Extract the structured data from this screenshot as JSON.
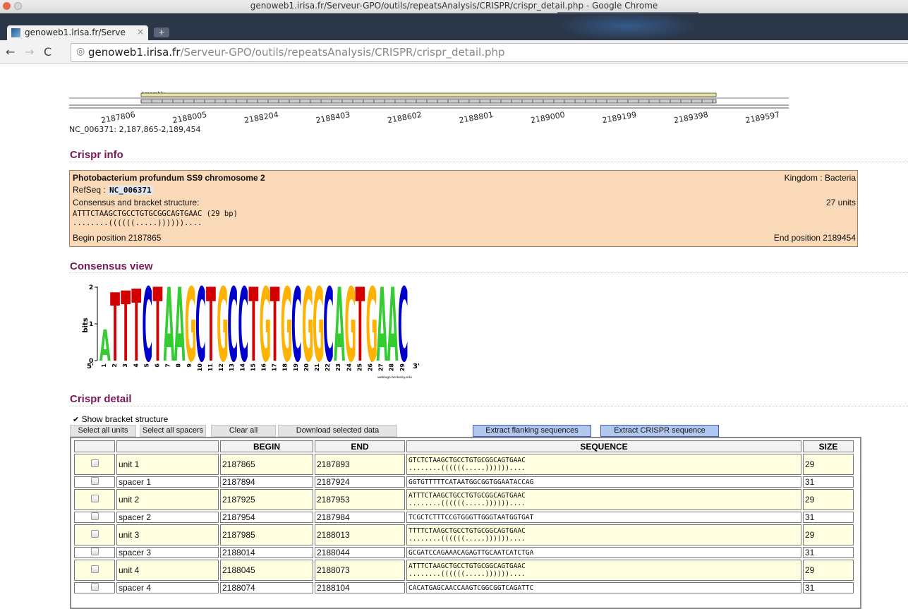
{
  "window": {
    "title": "genoweb1.irisa.fr/Serveur-GPO/outils/repeatsAnalysis/CRISPR/crispr_detail.php - Google Chrome"
  },
  "tab": {
    "label": "genoweb1.irisa.fr/Serve",
    "close": "×"
  },
  "address": {
    "host": "genoweb1.irisa.fr",
    "path": "/Serveur-GPO/outils/repeatsAnalysis/CRISPR/crispr_detail.php"
  },
  "ruler": {
    "track_label": "Assembly",
    "ticks": [
      "2187806",
      "2188005",
      "2188204",
      "2188403",
      "2188602",
      "2188801",
      "2189000",
      "2189199",
      "2189398",
      "2189597"
    ],
    "range_label": "NC_006371: 2,187,865-2,189,454"
  },
  "info": {
    "title": "Crispr info",
    "organism": "Photobacterium profundum SS9 chromosome 2",
    "kingdom": "Kingdom : Bacteria",
    "refseq_label": "RefSeq :",
    "refseq_value": "NC_006371",
    "consensus_label": "Consensus and bracket structure:",
    "units": "27 units",
    "consensus_seq": "ATTTCTAAGCTGCCTGTGCGGCAGTGAAC (29 bp)",
    "bracket": "........((((((.....))))))....",
    "begin": "Begin position 2187865",
    "end": "End position 2189454"
  },
  "consensus_view": {
    "title": "Consensus view",
    "y_axis": "bits",
    "y_ticks": [
      "0",
      "1",
      "2"
    ],
    "end5": "5'",
    "end3": "3'",
    "credit": "weblogo.berkeley.edu",
    "letters": "ATTTCTAAGCTGCCTGTGCGGCAGTGAAC",
    "positions": [
      "1",
      "2",
      "3",
      "4",
      "5",
      "6",
      "7",
      "8",
      "9",
      "10",
      "11",
      "12",
      "13",
      "14",
      "15",
      "16",
      "17",
      "18",
      "19",
      "20",
      "21",
      "22",
      "23",
      "24",
      "25",
      "26",
      "27",
      "28",
      "29"
    ],
    "colors": {
      "A": "#33cc33",
      "T": "#d40000",
      "C": "#0000cc",
      "G": "#ffb300"
    }
  },
  "detail": {
    "title": "Crispr detail",
    "show_bracket": "Show bracket structure",
    "buttons": [
      "Select all units",
      "Select all spacers",
      "Clear all",
      "Download selected data"
    ],
    "blue_buttons": [
      "Extract flanking sequences",
      "Extract CRISPR sequence"
    ],
    "headers": [
      "",
      "",
      "BEGIN",
      "END",
      "SEQUENCE",
      "SIZE"
    ],
    "rows": [
      {
        "type": "unit",
        "name": "unit 1",
        "begin": "2187865",
        "end": "2187893",
        "seq": "GTCTCTAAGCTGCCTGTGCGGCAGTGAAC",
        "bracket": "........((((((.....))))))....",
        "size": "29"
      },
      {
        "type": "spacer",
        "name": "spacer 1",
        "begin": "2187894",
        "end": "2187924",
        "seq": "GGTGTTTTTCATAATGGCGGTGGAATACCAG",
        "size": "31"
      },
      {
        "type": "unit",
        "name": "unit 2",
        "begin": "2187925",
        "end": "2187953",
        "seq": "ATTTCTAAGCTGCCTGTGCGGCAGTGAAC",
        "bracket": "........((((((.....))))))....",
        "size": "29"
      },
      {
        "type": "spacer",
        "name": "spacer 2",
        "begin": "2187954",
        "end": "2187984",
        "seq": "TCGCTCTTTCCGTGGGTTGGGTAATGGTGAT",
        "size": "31"
      },
      {
        "type": "unit",
        "name": "unit 3",
        "begin": "2187985",
        "end": "2188013",
        "seq": "TTTTCTAAGCTGCCTGTGCGGCAGTGAAC",
        "bracket": "........((((((.....))))))....",
        "size": "29"
      },
      {
        "type": "spacer",
        "name": "spacer 3",
        "begin": "2188014",
        "end": "2188044",
        "seq": "GCGATCCAGAAACAGAGTTGCAATCATCTGA",
        "size": "31"
      },
      {
        "type": "unit",
        "name": "unit 4",
        "begin": "2188045",
        "end": "2188073",
        "seq": "ATTTCTAAGCTGCCTGTGCGGCAGTGAAC",
        "bracket": "........((((((.....))))))....",
        "size": "29"
      },
      {
        "type": "spacer",
        "name": "spacer 4",
        "begin": "2188074",
        "end": "2188104",
        "seq": "CACATGAGCAACCAAGTCGGCGGTCAGATTC",
        "size": "31"
      }
    ]
  }
}
